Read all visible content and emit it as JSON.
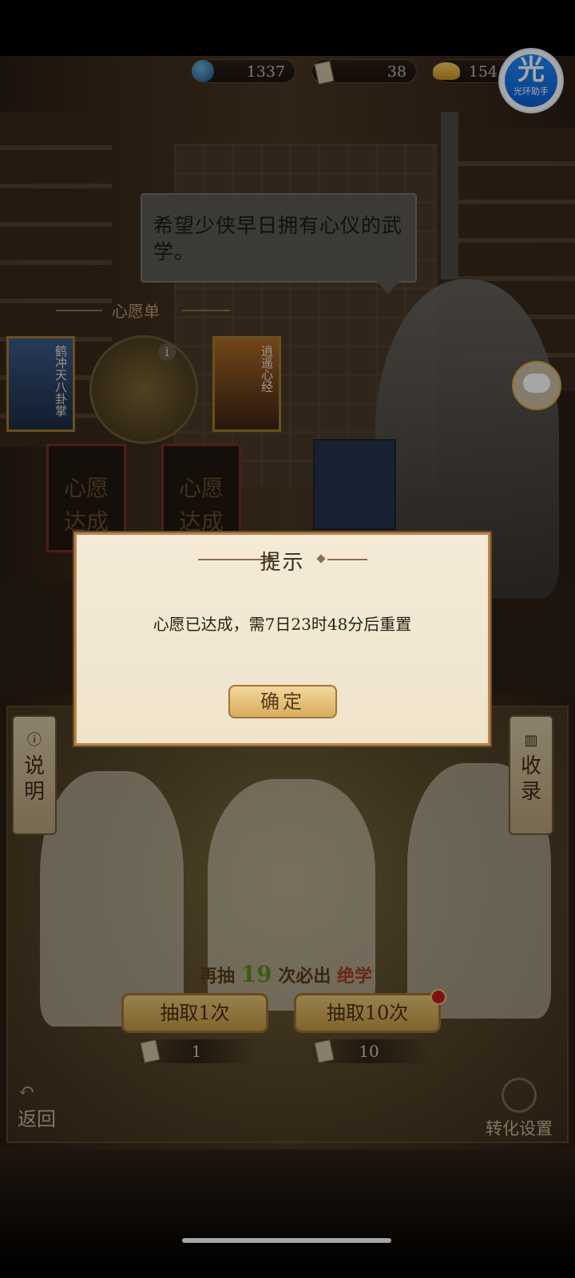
{
  "currency": {
    "jade": "1337",
    "tickets": "38",
    "gold": "154"
  },
  "helper_badge": {
    "glyph": "光",
    "label": "光环助手"
  },
  "npc_speech": "希望少侠早日拥有心仪的武学。",
  "wishlist": {
    "title": "心愿单",
    "info_glyph": "i",
    "cards": [
      {
        "name": "鹤冲天八卦掌",
        "icon": "martial-art-card"
      },
      {
        "name": "逍遥心经",
        "icon": "martial-art-card"
      }
    ],
    "slot_text": "心愿\n达成",
    "center_icon": "wish-emblem-icon"
  },
  "dialog": {
    "title": "提示",
    "message": "心愿已达成，需7日23时48分后重置",
    "confirm": "确定"
  },
  "gacha": {
    "explain_label": "说\n明",
    "collection_label": "收\n录",
    "pity_prefix": "再抽",
    "pity_count": "19",
    "pity_mid": "次必出",
    "pity_item": "绝学",
    "draw_once": {
      "label": "抽取1次",
      "cost": "1"
    },
    "draw_ten": {
      "label": "抽取10次",
      "cost": "10",
      "has_badge": true
    },
    "back": "返回",
    "convert": "转化设置"
  },
  "colors": {
    "accent_gold": "#c79a45",
    "dialog_bg": "#f4ead7",
    "pity_green": "#5e8a1e",
    "badge_red": "#c0201c",
    "helper_blue": "#1f8bff"
  }
}
